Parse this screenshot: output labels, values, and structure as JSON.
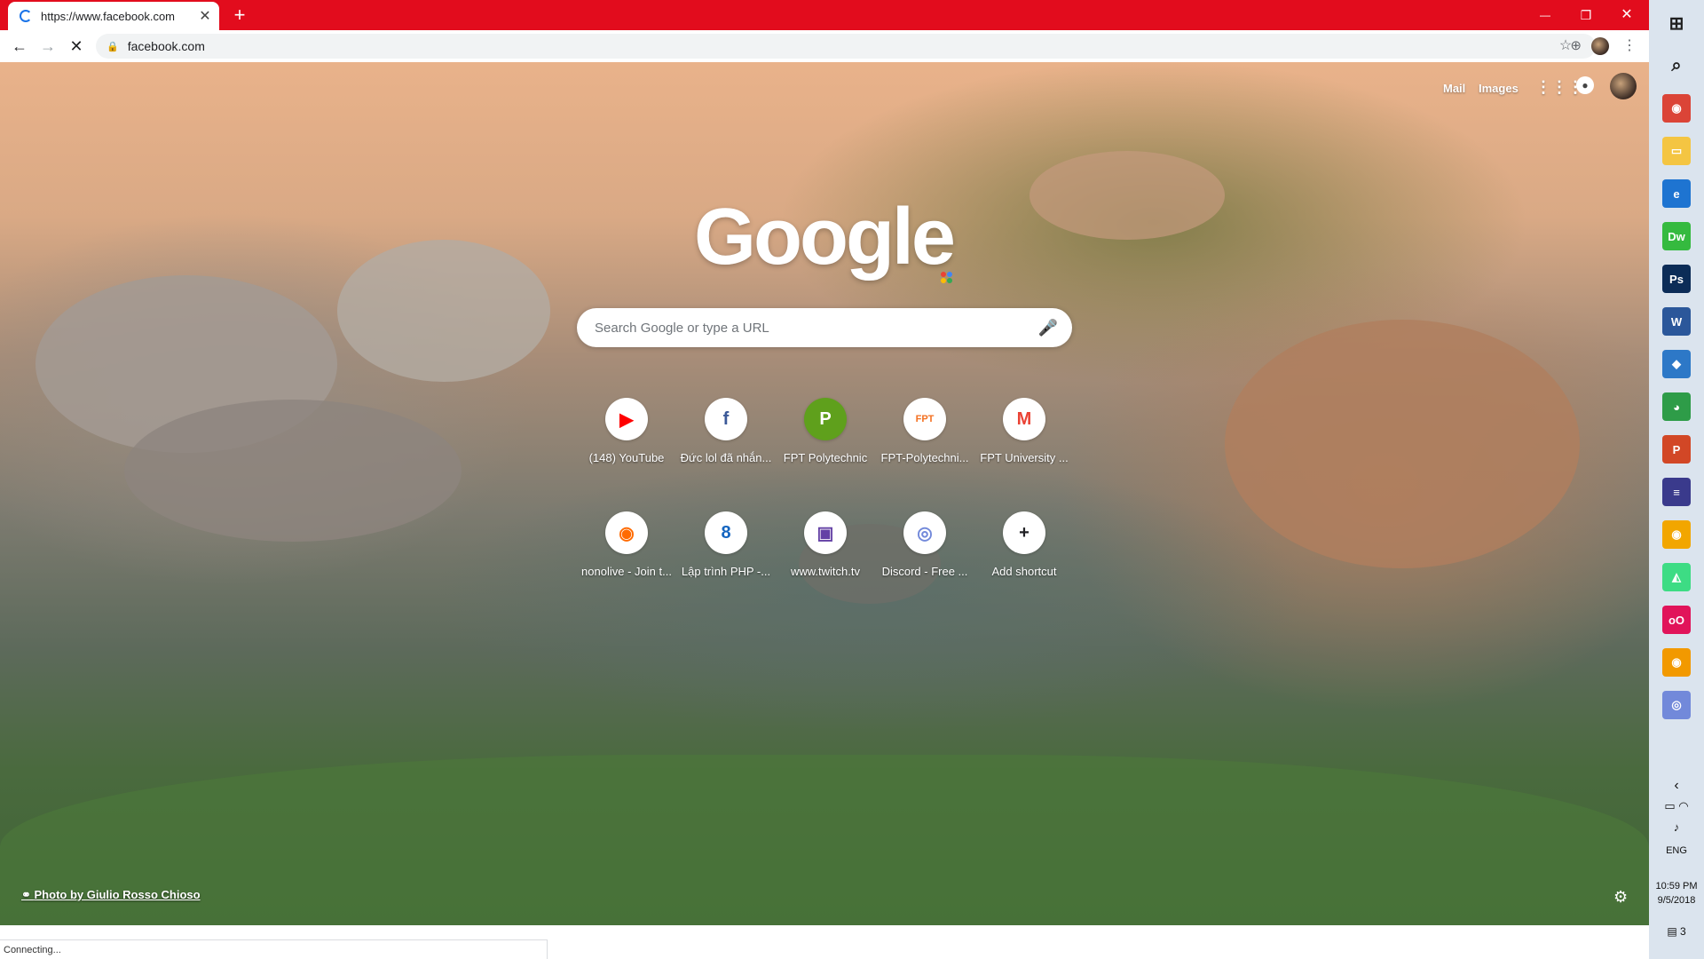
{
  "browser": {
    "tab": {
      "title": "https://www.facebook.com",
      "close": "✕"
    },
    "new_tab": "+",
    "window_controls": {
      "minimize": "—",
      "restore": "❐",
      "close": "✕"
    },
    "omnibox": {
      "url": "facebook.com"
    },
    "status": "Connecting..."
  },
  "ntp": {
    "top_links": {
      "mail": "Mail",
      "images": "Images"
    },
    "logo": "Google",
    "search": {
      "placeholder": "Search Google or type a URL"
    },
    "shortcuts": [
      {
        "label": "(148) YouTube",
        "glyph": "▶",
        "color": "#ff0000"
      },
      {
        "label": "Đức lol đã nhắn...",
        "glyph": "f",
        "color": "#3b5998"
      },
      {
        "label": "FPT Polytechnic",
        "glyph": "P",
        "color": "#ffffff"
      },
      {
        "label": "FPT-Polytechni...",
        "glyph": "FPT",
        "color": "#f37021"
      },
      {
        "label": "FPT University ...",
        "glyph": "M",
        "color": "#ea4335"
      },
      {
        "label": "nonolive - Join t...",
        "glyph": "◉",
        "color": "#ff6a00"
      },
      {
        "label": "Lập trình PHP -...",
        "glyph": "8",
        "color": "#1565c0"
      },
      {
        "label": "www.twitch.tv",
        "glyph": "▣",
        "color": "#6441a5"
      },
      {
        "label": "Discord - Free ...",
        "glyph": "◎",
        "color": "#7289da"
      },
      {
        "label": "Add shortcut",
        "glyph": "+",
        "color": "#202124"
      }
    ],
    "attribution": "Photo by Giulio Rosso Chioso"
  },
  "taskbar": {
    "apps": [
      {
        "name": "start",
        "glyph": "⊞",
        "color": "#1f1f1f"
      },
      {
        "name": "search",
        "glyph": "⌕",
        "color": "#1f1f1f"
      },
      {
        "name": "chrome",
        "glyph": "◉",
        "color": "#db4437"
      },
      {
        "name": "file-explorer",
        "glyph": "▭",
        "color": "#f4c542"
      },
      {
        "name": "edge",
        "glyph": "e",
        "color": "#1e74d1"
      },
      {
        "name": "dreamweaver",
        "glyph": "Dw",
        "color": "#35ba3f"
      },
      {
        "name": "photoshop",
        "glyph": "Ps",
        "color": "#0c2c57"
      },
      {
        "name": "word",
        "glyph": "W",
        "color": "#2b579a"
      },
      {
        "name": "cube-app",
        "glyph": "◆",
        "color": "#2d78c7"
      },
      {
        "name": "globe-app",
        "glyph": "◕",
        "color": "#2e9c48"
      },
      {
        "name": "powerpoint",
        "glyph": "P",
        "color": "#d24726"
      },
      {
        "name": "flag-app",
        "glyph": "≡",
        "color": "#3a3a8c"
      },
      {
        "name": "chrome-canary",
        "glyph": "◉",
        "color": "#f2a600"
      },
      {
        "name": "android-app",
        "glyph": "◭",
        "color": "#3ddc84"
      },
      {
        "name": "red-app",
        "glyph": "oO",
        "color": "#e1145a"
      },
      {
        "name": "chrome-2",
        "glyph": "◉",
        "color": "#f29900"
      },
      {
        "name": "discord",
        "glyph": "◎",
        "color": "#7289da"
      }
    ],
    "language": "ENG",
    "time": "10:59 PM",
    "date": "9/5/2018",
    "notifications": "3"
  }
}
